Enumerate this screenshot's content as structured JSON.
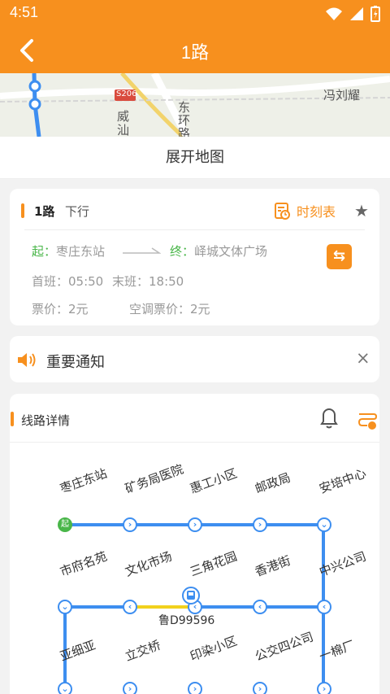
{
  "status_bar": {
    "time": "4:51"
  },
  "header": {
    "title": "1路"
  },
  "map": {
    "labels": {
      "label_1": "S206",
      "label_2": "威",
      "label_3": "汕",
      "label_4": "东",
      "label_5": "环",
      "label_6": "路",
      "label_7": "冯刘耀"
    }
  },
  "expand_map": "展开地图",
  "route": {
    "name": "1路",
    "direction": "下行",
    "timetable": "时刻表",
    "start_prefix": "起：",
    "start_station": "枣庄东站",
    "end_prefix": "终：",
    "end_station": "峄城文体广场",
    "first_bus": "首班：05:50",
    "last_bus": "末班：18:50",
    "fare": "票价：2元",
    "ac_fare": "空调票价：2元"
  },
  "notice": {
    "title": "重要通知"
  },
  "details": {
    "title": "线路详情",
    "stop_marker_start": "起",
    "stops": [
      "枣庄东站",
      "矿务局医院",
      "惠工小区",
      "邮政局",
      "安培中心",
      "中兴公司",
      "香港街",
      "三角花园",
      "文化市场",
      "市府名苑",
      "亚细亚",
      "立交桥",
      "印染小区",
      "公交四公司",
      "一棉厂"
    ],
    "bus_plate": "鲁D99596"
  },
  "colors": {
    "accent": "#f7901e",
    "route_blue": "#3d8ef0",
    "start_green": "#49b649",
    "bus_yellow": "#f2d11c"
  }
}
